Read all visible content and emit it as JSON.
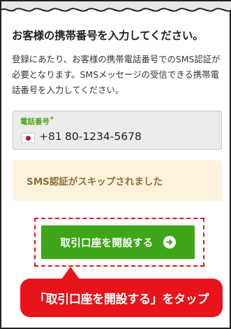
{
  "header": {
    "title": "お客様の携帯番号を入力してください。",
    "description": "登録にあたり、お客様の携帯電話番号でのSMS認証が必要となります。SMSメッセージの受信できる携帯電話番号を入力してください。"
  },
  "phone_field": {
    "label": "電話番号",
    "required_mark": "*",
    "flag_icon": "japan-flag-icon",
    "country_code": "+81",
    "value": "80-1234-5678"
  },
  "sms_notice": {
    "text": "SMS認証がスキップされました"
  },
  "primary_button": {
    "label": "取引口座を開設する",
    "icon": "arrow-right-circle-icon",
    "color": "#3fa61a"
  },
  "callout": {
    "text": "「取引口座を開設する」をタップ",
    "color": "#e8131b"
  }
}
